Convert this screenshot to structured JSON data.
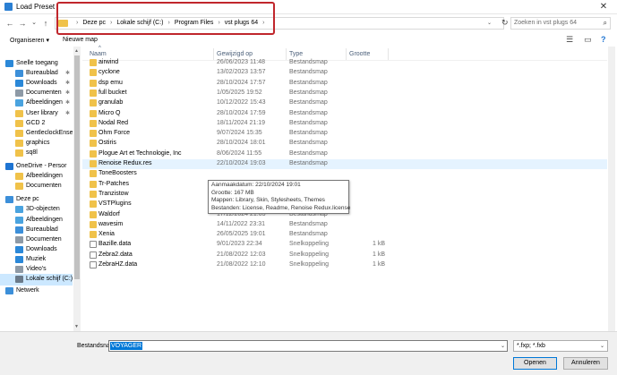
{
  "window": {
    "title": "Load Preset",
    "close_glyph": "✕"
  },
  "nav": {
    "back_glyph": "←",
    "forward_glyph": "→",
    "dropdown_glyph": "⌄",
    "up_glyph": "↑",
    "refresh_glyph": "↻"
  },
  "address": {
    "crumbs": [
      "Deze pc",
      "Lokale schijf (C:)",
      "Program Files",
      "vst plugs 64"
    ],
    "separator": "›",
    "dropdown_glyph": "⌄"
  },
  "search": {
    "placeholder": "Zoeken in vst plugs 64",
    "icon_glyph": "⌕"
  },
  "toolbar": {
    "organize_label": "Organiseren ▾",
    "new_folder_label": "Nieuwe map",
    "view_glyph": "☰",
    "pane_glyph": "▭",
    "help_glyph": "?"
  },
  "sidebar": {
    "items": [
      {
        "label": "Snelle toegang",
        "icon": "star-icon",
        "color": "#2b88d8",
        "pinned": false
      },
      {
        "label": "Bureaublad",
        "icon": "desktop-icon",
        "color": "#3c8fd9",
        "pinned": true
      },
      {
        "label": "Downloads",
        "icon": "download-icon",
        "color": "#2b88d8",
        "pinned": true
      },
      {
        "label": "Documenten",
        "icon": "document-icon",
        "color": "#8e9aa6",
        "pinned": true
      },
      {
        "label": "Afbeeldingen",
        "icon": "picture-icon",
        "color": "#4aa3df",
        "pinned": true
      },
      {
        "label": "User library",
        "icon": "folder-icon",
        "color": "#f0c24a",
        "pinned": true
      },
      {
        "label": "GCD 2",
        "icon": "folder-icon",
        "color": "#f0c24a",
        "pinned": false
      },
      {
        "label": "GentleclockEnse",
        "icon": "folder-icon",
        "color": "#f0c24a",
        "pinned": false
      },
      {
        "label": "graphics",
        "icon": "folder-icon",
        "color": "#f0c24a",
        "pinned": false
      },
      {
        "label": "sq8l",
        "icon": "folder-icon",
        "color": "#f0c24a",
        "pinned": false
      },
      {
        "label": "OneDrive - Persor",
        "icon": "cloud-icon",
        "color": "#1e74d2",
        "pinned": false
      },
      {
        "label": "Afbeeldingen",
        "icon": "folder-icon",
        "color": "#f0c24a",
        "pinned": false
      },
      {
        "label": "Documenten",
        "icon": "folder-icon",
        "color": "#f0c24a",
        "pinned": false
      },
      {
        "label": "Deze pc",
        "icon": "computer-icon",
        "color": "#3c8fd9",
        "pinned": false
      },
      {
        "label": "3D-objecten",
        "icon": "cube-icon",
        "color": "#4aa3df",
        "pinned": false
      },
      {
        "label": "Afbeeldingen",
        "icon": "picture-icon",
        "color": "#4aa3df",
        "pinned": false
      },
      {
        "label": "Bureaublad",
        "icon": "desktop-icon",
        "color": "#3c8fd9",
        "pinned": false
      },
      {
        "label": "Documenten",
        "icon": "document-icon",
        "color": "#8e9aa6",
        "pinned": false
      },
      {
        "label": "Downloads",
        "icon": "download-icon",
        "color": "#2b88d8",
        "pinned": false
      },
      {
        "label": "Muziek",
        "icon": "music-icon",
        "color": "#2b88d8",
        "pinned": false
      },
      {
        "label": "Video's",
        "icon": "video-icon",
        "color": "#8e9aa6",
        "pinned": false
      },
      {
        "label": "Lokale schijf (C:)",
        "icon": "drive-icon",
        "color": "#6a7a8a",
        "pinned": false
      },
      {
        "label": "Netwerk",
        "icon": "network-icon",
        "color": "#3c8fd9",
        "pinned": false
      }
    ],
    "selected_index": 21,
    "pin_glyph": "✱"
  },
  "columns": {
    "name": "Naam",
    "date": "Gewijzigd op",
    "type": "Type",
    "size": "Grootte",
    "sort_glyph": "^"
  },
  "files": [
    {
      "name": "airwind",
      "date": "26/06/2023 11:48",
      "type": "Bestandsmap",
      "size": "",
      "kind": "folder"
    },
    {
      "name": "cyclone",
      "date": "13/02/2023 13:57",
      "type": "Bestandsmap",
      "size": "",
      "kind": "folder"
    },
    {
      "name": "dsp emu",
      "date": "28/10/2024 17:57",
      "type": "Bestandsmap",
      "size": "",
      "kind": "folder"
    },
    {
      "name": "full bucket",
      "date": "1/05/2025 19:52",
      "type": "Bestandsmap",
      "size": "",
      "kind": "folder"
    },
    {
      "name": "granulab",
      "date": "10/12/2022 15:43",
      "type": "Bestandsmap",
      "size": "",
      "kind": "folder"
    },
    {
      "name": "Micro Q",
      "date": "28/10/2024 17:59",
      "type": "Bestandsmap",
      "size": "",
      "kind": "folder"
    },
    {
      "name": "Nodal Red",
      "date": "18/11/2024 21:19",
      "type": "Bestandsmap",
      "size": "",
      "kind": "folder"
    },
    {
      "name": "Ohm Force",
      "date": "9/07/2024 15:35",
      "type": "Bestandsmap",
      "size": "",
      "kind": "folder"
    },
    {
      "name": "Ostiris",
      "date": "28/10/2024 18:01",
      "type": "Bestandsmap",
      "size": "",
      "kind": "folder"
    },
    {
      "name": "Plogue Art et Technologie, Inc",
      "date": "8/06/2024 11:55",
      "type": "Bestandsmap",
      "size": "",
      "kind": "folder"
    },
    {
      "name": "Renoise Redux.res",
      "date": "22/10/2024 19:03",
      "type": "Bestandsmap",
      "size": "",
      "kind": "folder"
    },
    {
      "name": "ToneBoosters",
      "date": "",
      "type": "",
      "size": "",
      "kind": "folder"
    },
    {
      "name": "Tr-Patches",
      "date": "",
      "type": "",
      "size": "",
      "kind": "folder"
    },
    {
      "name": "Tranzistow",
      "date": "",
      "type": "",
      "size": "",
      "kind": "folder"
    },
    {
      "name": "VSTPlugins",
      "date": "11/04/2023 23:01",
      "type": "Bestandsmap",
      "size": "",
      "kind": "folder"
    },
    {
      "name": "Waldorf",
      "date": "17/12/2024 21:03",
      "type": "Bestandsmap",
      "size": "",
      "kind": "folder"
    },
    {
      "name": "wavesim",
      "date": "14/11/2022 23:31",
      "type": "Bestandsmap",
      "size": "",
      "kind": "folder"
    },
    {
      "name": "Xenia",
      "date": "26/05/2025 19:01",
      "type": "Bestandsmap",
      "size": "",
      "kind": "folder"
    },
    {
      "name": "Bazille.data",
      "date": "9/01/2023 22:34",
      "type": "Snelkoppeling",
      "size": "1 kB",
      "kind": "data"
    },
    {
      "name": "Zebra2.data",
      "date": "21/08/2022 12:03",
      "type": "Snelkoppeling",
      "size": "1 kB",
      "kind": "data"
    },
    {
      "name": "ZebraHZ.data",
      "date": "21/08/2022 12:10",
      "type": "Snelkoppeling",
      "size": "1 kB",
      "kind": "data"
    }
  ],
  "hover_index": 10,
  "tooltip": {
    "lines": [
      "Aanmaakdatum: 22/10/2024 19:01",
      "Grootte: 167 MB",
      "Mappen: Library, Skin, Stylesheets, Themes",
      "Bestanden: License, Readme, Renoise Redux.license"
    ]
  },
  "footer": {
    "filename_label": "Bestandsnaam:",
    "filename_value": "VOYAGER",
    "filetype_value": "*.fxp; *.fxb",
    "dropdown_glyph": "⌄",
    "open_label": "Openen",
    "cancel_label": "Annuleren"
  }
}
